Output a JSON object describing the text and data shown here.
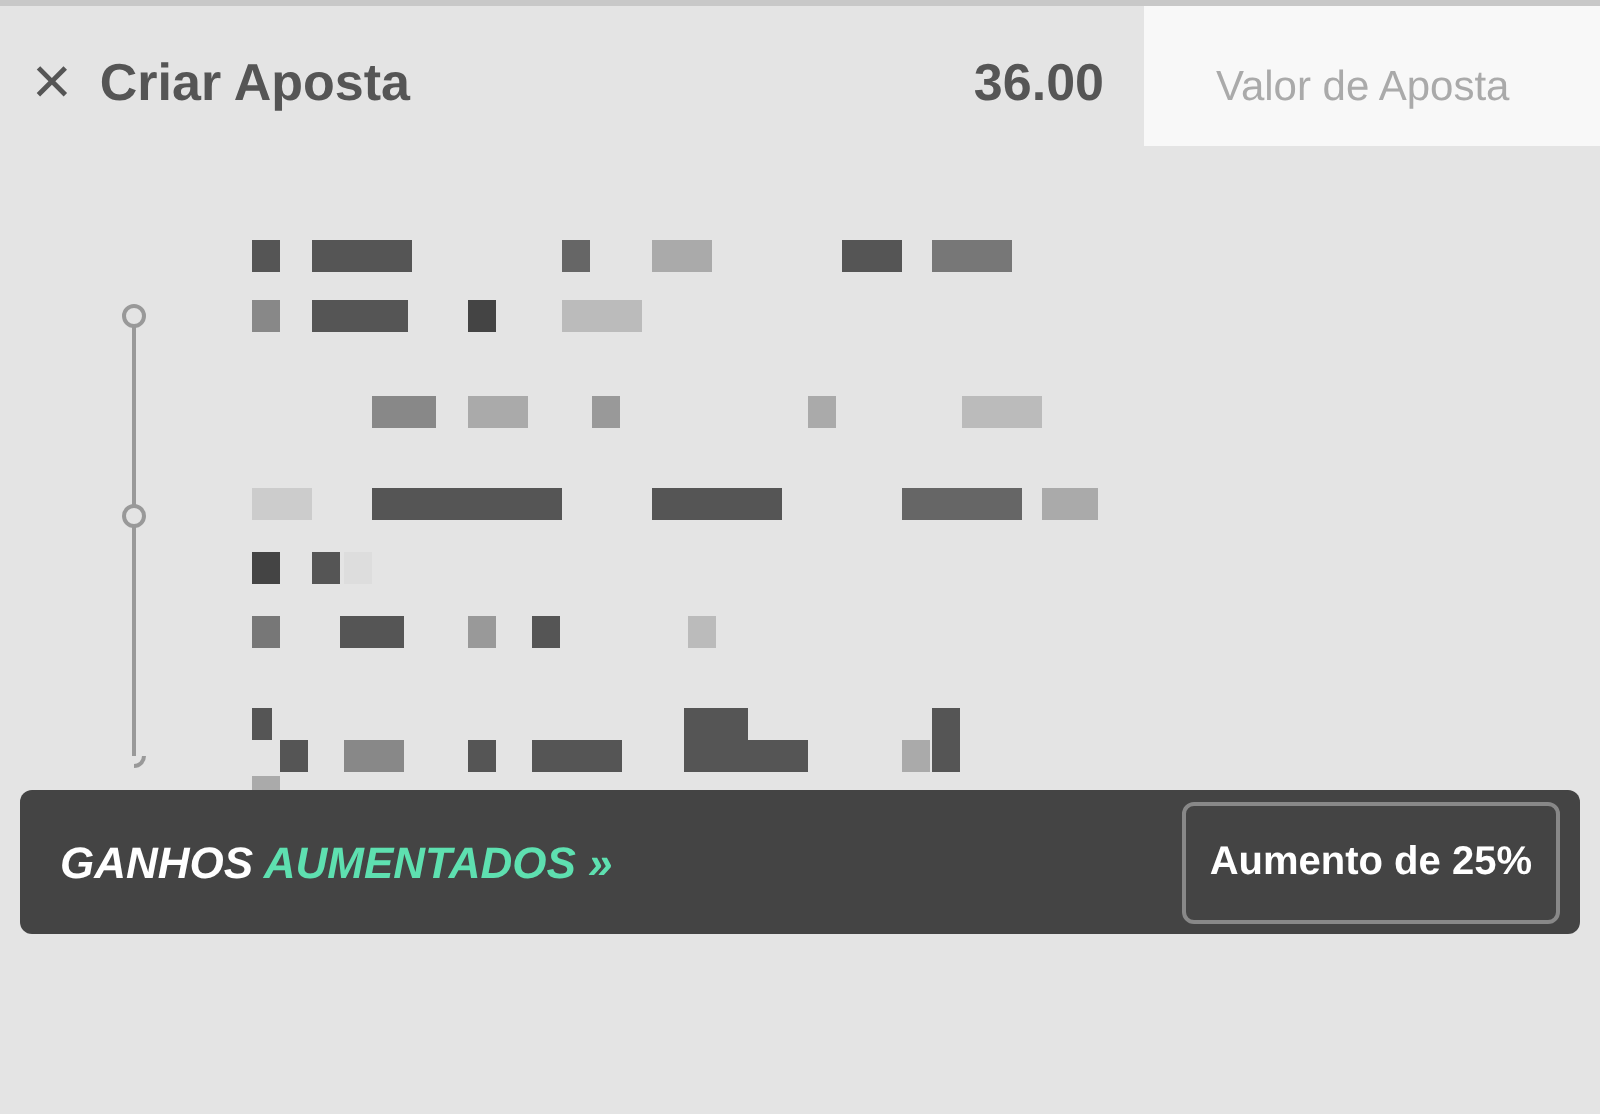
{
  "header": {
    "close": "×",
    "title": "Criar Aposta",
    "amount": "36.00"
  },
  "stake_field": {
    "placeholder": "Valor de Aposta"
  },
  "boost_banner": {
    "label_plain": "GANHOS",
    "label_accent": "AUMENTADOS",
    "chevrons": "»",
    "button": "Aumento de 25%"
  }
}
